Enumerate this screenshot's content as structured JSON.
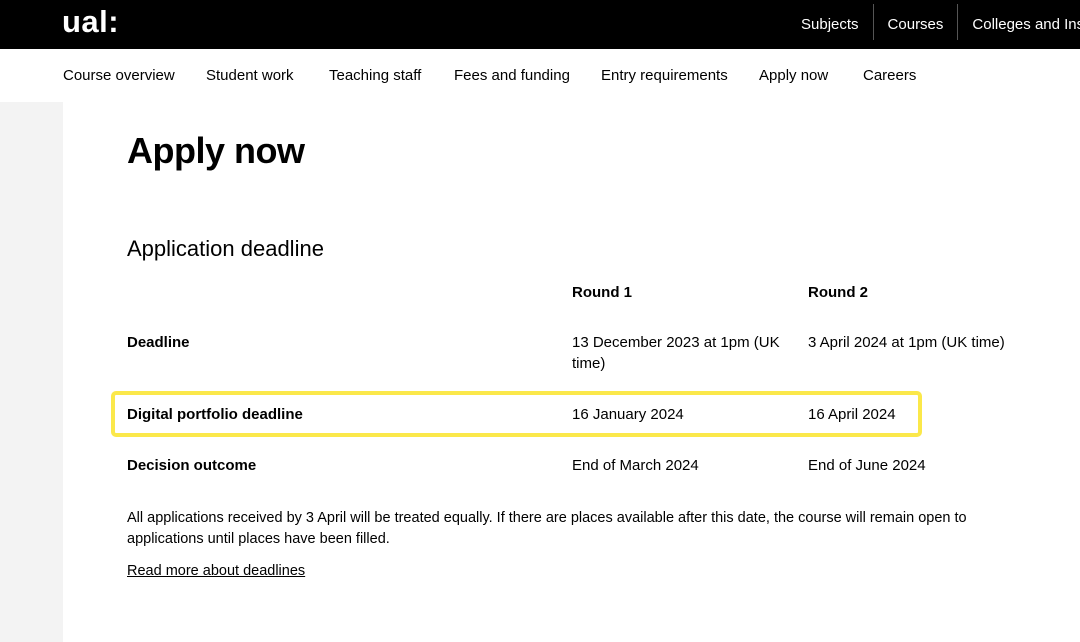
{
  "header": {
    "logo": "ual:",
    "nav": [
      "Subjects",
      "Courses",
      "Colleges and Inst"
    ]
  },
  "subnav": {
    "items": [
      "Course overview",
      "Student work",
      "Teaching staff",
      "Fees and funding",
      "Entry requirements",
      "Apply now",
      "Careers"
    ]
  },
  "main": {
    "title": "Apply now",
    "section_title": "Application deadline",
    "table": {
      "columns": [
        "Round 1",
        "Round 2"
      ],
      "rows": [
        {
          "label": "Deadline",
          "round1": "13 December 2023 at 1pm (UK time)",
          "round2": "3 April 2024 at 1pm (UK time)"
        },
        {
          "label": "Digital portfolio deadline",
          "round1": "16 January 2024",
          "round2": "16 April 2024"
        },
        {
          "label": "Decision outcome",
          "round1": "End of March 2024",
          "round2": "End of June 2024"
        }
      ]
    },
    "note": "All applications received by 3 April will be treated equally. If there are places available after this date, the course will remain open to applications until places have been filled.",
    "read_more_link": "Read more about deadlines"
  },
  "colors": {
    "header_bg": "#000000",
    "highlight": "#fbe84a",
    "side_panel": "#f3f3f3"
  }
}
